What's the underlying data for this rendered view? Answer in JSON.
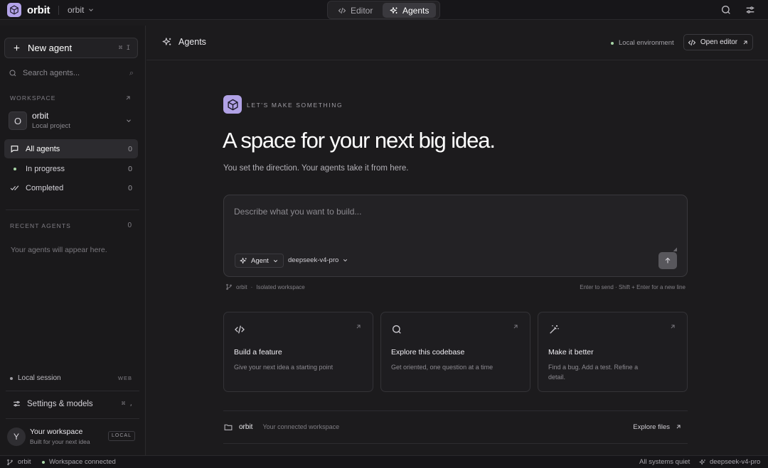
{
  "app": {
    "brand": "orbit",
    "workspace_switch": "orbit",
    "colors": {
      "accent": "#b3a3e9",
      "background": "#1c1b1d"
    }
  },
  "top_tabs": [
    {
      "label": "Editor",
      "icon": "code-icon",
      "active": false
    },
    {
      "label": "Agents",
      "icon": "sparkles-icon",
      "active": true
    }
  ],
  "sidebar": {
    "new_agent_label": "New agent",
    "new_agent_shortcut": "⌘ I",
    "search_placeholder": "Search agents...",
    "search_shortcut": "⌕",
    "workspace_label": "WORKSPACE",
    "workspace": {
      "avatar": "O",
      "name": "orbit",
      "subtitle": "Local project"
    },
    "nav": [
      {
        "label": "All agents",
        "count": "0",
        "icon": "chat-icon",
        "active": true
      },
      {
        "label": "In progress",
        "count": "0",
        "icon": "dot-icon",
        "active": false
      },
      {
        "label": "Completed",
        "count": "0",
        "icon": "double-check-icon",
        "active": false
      }
    ],
    "recent_label": "RECENT AGENTS",
    "recent_count": "0",
    "recent_empty": "Your agents will appear here.",
    "session_label": "Local session",
    "session_tag": "WEB",
    "settings_label": "Settings & models",
    "settings_shortcut": "⌘ ,",
    "user": {
      "avatar": "Y",
      "name": "Your workspace",
      "subtitle": "Built for your next idea",
      "badge": "LOCAL"
    }
  },
  "main_header": {
    "title": "Agents",
    "environment": "Local environment",
    "open_editor_label": "Open editor"
  },
  "hero": {
    "eyebrow": "LET'S MAKE SOMETHING",
    "headline": "A space for your next big idea.",
    "subline": "You set the direction. Your agents take it from here."
  },
  "prompt": {
    "placeholder": "Describe what you want to build...",
    "value": "",
    "mode_label": "Agent",
    "model_label": "deepseek-v4-pro",
    "meta_workspace": "orbit",
    "meta_separator": "·",
    "meta_isolation": "Isolated workspace",
    "hint": "Enter to send · Shift + Enter for a new line"
  },
  "cards": [
    {
      "icon": "code-icon",
      "title": "Build a feature",
      "description": "Give your next idea a starting point"
    },
    {
      "icon": "search-icon",
      "title": "Explore this codebase",
      "description": "Get oriented, one question at a time"
    },
    {
      "icon": "magic-wand-icon",
      "title": "Make it better",
      "description": "Find a bug. Add a test. Refine a detail."
    }
  ],
  "workspace_row": {
    "name": "orbit",
    "subtitle": "Your connected workspace",
    "link_label": "Explore files"
  },
  "statusbar": {
    "branch": "orbit",
    "connection": "Workspace connected",
    "health": "All systems quiet",
    "model": "deepseek-v4-pro"
  }
}
